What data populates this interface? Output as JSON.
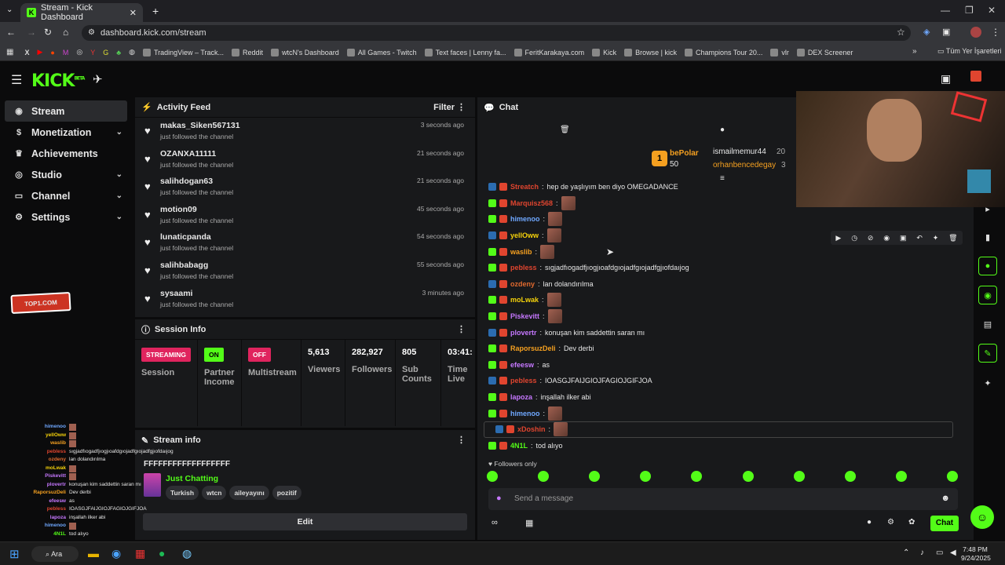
{
  "browser": {
    "tab_title": "Stream - Kick Dashboard",
    "url": "dashboard.kick.com/stream"
  },
  "bookmarks": [
    "TradingView – Track...",
    "Reddit",
    "wtcN's Dashboard",
    "All Games - Twitch",
    "Text faces | Lenny fa...",
    "FeritKarakaya.com",
    "Kick",
    "Browse | kick",
    "Champions Tour 20...",
    "vlr",
    "DEX Screener"
  ],
  "bookmarks_all": "Tüm Yer İşaretleri",
  "logo": {
    "text": "KICK",
    "beta": "BETA"
  },
  "sidebar": [
    {
      "label": "Stream",
      "icon": "radio-icon",
      "chev": false
    },
    {
      "label": "Monetization",
      "icon": "money-icon",
      "chev": true
    },
    {
      "label": "Achievements",
      "icon": "trophy-icon",
      "chev": false
    },
    {
      "label": "Studio",
      "icon": "studio-icon",
      "chev": true
    },
    {
      "label": "Channel",
      "icon": "channel-icon",
      "chev": true
    },
    {
      "label": "Settings",
      "icon": "gear-icon",
      "chev": true
    }
  ],
  "activity": {
    "title": "Activity Feed",
    "filter": "Filter",
    "items": [
      {
        "user": "makas_Siken567131",
        "action": "just followed the channel",
        "time": "3 seconds ago"
      },
      {
        "user": "OZANXA11111",
        "action": "just followed the channel",
        "time": "21 seconds ago"
      },
      {
        "user": "salihdogan63",
        "action": "just followed the channel",
        "time": "21 seconds ago"
      },
      {
        "user": "motion09",
        "action": "just followed the channel",
        "time": "45 seconds ago"
      },
      {
        "user": "lunaticpanda",
        "action": "just followed the channel",
        "time": "54 seconds ago"
      },
      {
        "user": "salihbabagg",
        "action": "just followed the channel",
        "time": "55 seconds ago"
      },
      {
        "user": "sysaami",
        "action": "just followed the channel",
        "time": "3 minutes ago"
      }
    ]
  },
  "session": {
    "title": "Session Info",
    "streaming": "STREAMING",
    "session": "Session",
    "on": "ON",
    "partner": "Partner Income",
    "off": "OFF",
    "multistream": "Multistream",
    "viewers": "5,613",
    "viewers_label": "Viewers",
    "followers": "282,927",
    "followers_label": "Followers",
    "subs": "805",
    "subs_label": "Sub Counts",
    "time": "03:41:",
    "time_label": "Time Live"
  },
  "streaminfo": {
    "title": "Stream info",
    "stream_title": "FFFFFFFFFFFFFFFFFF",
    "category": "Just Chatting",
    "tags": [
      "Turkish",
      "wtcn",
      "aileyayını",
      "pozitif"
    ],
    "edit": "Edit"
  },
  "chat": {
    "title": "Chat",
    "leaders": [
      {
        "rank": "1",
        "name": "bePolar",
        "count": "50"
      },
      {
        "name": "ismailmemur44",
        "count": "20"
      },
      {
        "name": "orhanbencedegay",
        "count": "3"
      }
    ],
    "lines": [
      {
        "user": "Streatch",
        "color": "#e0452f",
        "text": "hep de yaşlıyım ben diyo OMEGADANCE",
        "emote": false
      },
      {
        "user": "Marquisz568",
        "color": "#e0452f",
        "text": "",
        "emote": true
      },
      {
        "user": "himenoo",
        "color": "#6fa8ff",
        "text": "",
        "emote": true
      },
      {
        "user": "yellOww",
        "color": "#f5d20a",
        "text": "",
        "emote": true
      },
      {
        "user": "waslib",
        "color": "#f5a020",
        "text": "",
        "emote": true
      },
      {
        "user": "pebless",
        "color": "#e0452f",
        "text": "sıgjadfıogadfjıogjıoafdgıojadfgıojadfgjıofdaıjog",
        "emote": false
      },
      {
        "user": "ozdeny",
        "color": "#e06a2f",
        "text": "lan dolandırılma",
        "emote": false
      },
      {
        "user": "moLwak",
        "color": "#f5d20a",
        "text": "",
        "emote": true
      },
      {
        "user": "Piskevitt",
        "color": "#c678ff",
        "text": "",
        "emote": true
      },
      {
        "user": "plovertr",
        "color": "#c678ff",
        "text": "konuşan kim saddettin saran mı",
        "emote": false
      },
      {
        "user": "RaporsuzDeli",
        "color": "#f5a020",
        "text": "Dev derbi",
        "emote": false
      },
      {
        "user": "efeesw",
        "color": "#c678ff",
        "text": "as",
        "emote": false
      },
      {
        "user": "pebless",
        "color": "#e0452f",
        "text": "IOASGJFAIJGIOJFAGIOJGIFJOA",
        "emote": false
      },
      {
        "user": "lapoza",
        "color": "#c678ff",
        "text": "inşallah ilker abi",
        "emote": false
      },
      {
        "user": "himenoo",
        "color": "#6fa8ff",
        "text": "",
        "emote": true
      },
      {
        "user": "xDoshin",
        "color": "#e0452f",
        "text": "",
        "emote": true
      },
      {
        "user": "4N1L",
        "color": "#53fc18",
        "text": "tod alıyo",
        "emote": false
      }
    ],
    "followers_only": "Followers only",
    "placeholder": "Send a message",
    "chat_btn": "Chat"
  },
  "overlay_chat": [
    [
      "himenoo",
      ""
    ],
    [
      "yellOww",
      ""
    ],
    [
      "waslib",
      ""
    ],
    [
      "pebless",
      "sıgjadfıogadfjıogjıoafdgıojadfgıojadfgjıofdaıjog"
    ],
    [
      "ozdeny",
      "lan dolandırılma"
    ],
    [
      "moLwak",
      ""
    ],
    [
      "Piskevitt",
      ""
    ],
    [
      "plovertr",
      "konuşan kim saddettin saran mı"
    ],
    [
      "RaporsuzDeli",
      "Dev derbi"
    ],
    [
      "efeesw",
      "as"
    ],
    [
      "pebless",
      "IOASGJFAIJGIOJFAGIOJGIFJOA"
    ],
    [
      "lapoza",
      "inşallah ilker abi"
    ],
    [
      "himenoo",
      ""
    ],
    [
      "4N1L",
      "tod alıyo"
    ]
  ],
  "taskbar": {
    "search": "Ara",
    "time": "7:48 PM",
    "date": "9/24/2025"
  }
}
